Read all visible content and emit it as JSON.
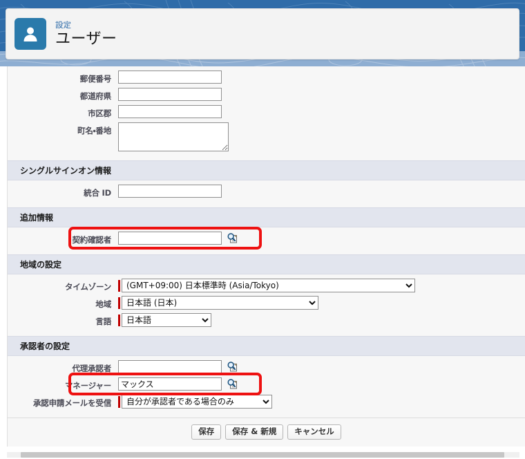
{
  "header": {
    "eyebrow": "設定",
    "title": "ユーザー",
    "icon": "user-avatar-icon",
    "icon_bg": "#2a7aab",
    "banner_color": "#2f6ca9",
    "eyebrow_color": "#2f6ca9"
  },
  "sections": [
    {
      "id": "address",
      "heading": "",
      "rows": [
        {
          "label": "郵便番号",
          "type": "text",
          "value": "",
          "required": false,
          "width": "w150"
        },
        {
          "label": "都道府県",
          "type": "text",
          "value": "",
          "required": false,
          "width": "w150"
        },
        {
          "label": "市区郡",
          "type": "text",
          "value": "",
          "required": false,
          "width": "w150"
        },
        {
          "label": "町名・番地",
          "type": "textarea",
          "value": "",
          "required": false
        }
      ]
    },
    {
      "id": "sso",
      "heading": "シングルサインオン情報",
      "rows": [
        {
          "label": "統合 ID",
          "type": "text",
          "value": "",
          "required": false,
          "width": "w150"
        }
      ]
    },
    {
      "id": "additional",
      "heading": "追加情報",
      "highlighted": true,
      "rows": [
        {
          "label": "契約確認者",
          "type": "lookup",
          "value": "",
          "required": false,
          "width": "w150",
          "lookup_icon": "lookup-magnifier-icon"
        }
      ]
    },
    {
      "id": "locale",
      "heading": "地域の設定",
      "rows": [
        {
          "label": "タイムゾーン",
          "type": "select",
          "value": "(GMT+09:00) 日本標準時 (Asia/Tokyo)",
          "required": true,
          "width": "w425"
        },
        {
          "label": "地域",
          "type": "select",
          "value": "日本語 (日本)",
          "required": true,
          "width": "w285"
        },
        {
          "label": "言語",
          "type": "select",
          "value": "日本語",
          "required": true,
          "width": "w130"
        }
      ]
    },
    {
      "id": "approver",
      "heading": "承認者の設定",
      "rows": [
        {
          "label": "代理承認者",
          "type": "lookup",
          "value": "",
          "required": false,
          "width": "w150",
          "lookup_icon": "lookup-magnifier-icon"
        },
        {
          "label": "マネージャー",
          "type": "lookup",
          "value": "マックス",
          "required": false,
          "width": "w150",
          "lookup_icon": "lookup-magnifier-icon",
          "highlighted": true
        },
        {
          "label": "承認申請メールを受信",
          "type": "select",
          "value": "自分が承認者である場合のみ",
          "required": true,
          "width": "w218"
        }
      ]
    }
  ],
  "footer": {
    "buttons": [
      {
        "label": "保存",
        "name": "save-button"
      },
      {
        "label": "保存 & 新規",
        "name": "save-and-new-button"
      },
      {
        "label": "キャンセル",
        "name": "cancel-button"
      }
    ]
  },
  "annotations": {
    "color": "#ee1111",
    "boxes": [
      {
        "target": "契約確認者"
      },
      {
        "target": "マネージャー"
      }
    ]
  }
}
